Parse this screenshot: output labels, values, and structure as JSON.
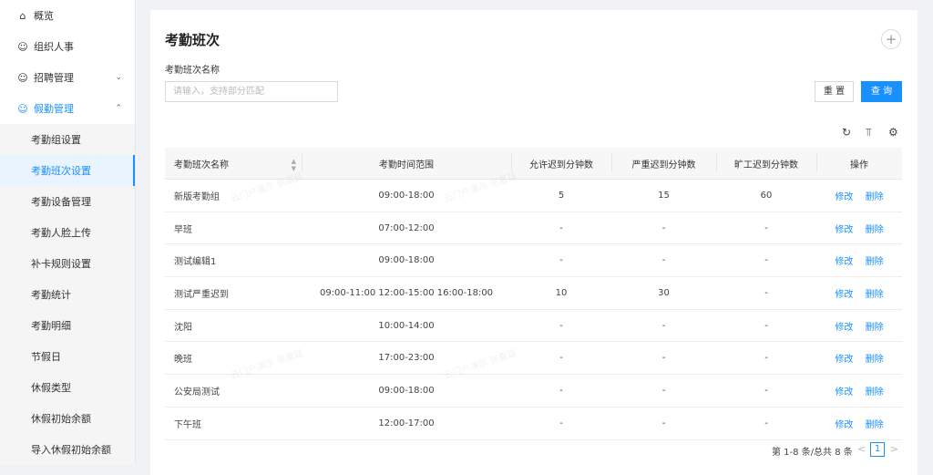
{
  "sidebar": {
    "top_items": [
      {
        "label": "概览",
        "icon": "home-icon"
      },
      {
        "label": "组织人事",
        "icon": "user-icon"
      },
      {
        "label": "招聘管理",
        "icon": "user-icon"
      },
      {
        "label": "假勤管理",
        "icon": "user-icon"
      }
    ],
    "sub_items": [
      {
        "label": "考勤组设置"
      },
      {
        "label": "考勤班次设置"
      },
      {
        "label": "考勤设备管理"
      },
      {
        "label": "考勤人脸上传"
      },
      {
        "label": "补卡规则设置"
      },
      {
        "label": "考勤统计"
      },
      {
        "label": "考勤明细"
      },
      {
        "label": "节假日"
      },
      {
        "label": "休假类型"
      },
      {
        "label": "休假初始余额"
      },
      {
        "label": "导入休假初始余额"
      }
    ],
    "active_sub": "考勤班次设置"
  },
  "page": {
    "title": "考勤班次",
    "add_button": "+"
  },
  "filter": {
    "label": "考勤班次名称",
    "placeholder": "请输入，支持部分匹配",
    "value": "",
    "reset_label": "重 置",
    "query_label": "查 询"
  },
  "toolbar": {
    "refresh_icon": "refresh-icon",
    "density_icon": "column-height-icon",
    "settings_icon": "gear-icon"
  },
  "table": {
    "headers": [
      "考勤班次名称",
      "考勤时间范围",
      "允许迟到分钟数",
      "严重迟到分钟数",
      "旷工迟到分钟数",
      "操作"
    ],
    "edit_label": "修改",
    "delete_label": "删除",
    "rows": [
      {
        "name": "新版考勤组",
        "range": "09:00-18:00",
        "allow": "5",
        "severe": "15",
        "absent": "60"
      },
      {
        "name": "早班",
        "range": "07:00-12:00",
        "allow": "-",
        "severe": "-",
        "absent": "-"
      },
      {
        "name": "测试编辑1",
        "range": "09:00-18:00",
        "allow": "-",
        "severe": "-",
        "absent": "-"
      },
      {
        "name": "测试严重迟到",
        "range": "09:00-11:00 12:00-15:00 16:00-18:00",
        "allow": "10",
        "severe": "30",
        "absent": "-"
      },
      {
        "name": "沈阳",
        "range": "10:00-14:00",
        "allow": "-",
        "severe": "-",
        "absent": "-"
      },
      {
        "name": "晚班",
        "range": "17:00-23:00",
        "allow": "-",
        "severe": "-",
        "absent": "-"
      },
      {
        "name": "公安局测试",
        "range": "09:00-18:00",
        "allow": "-",
        "severe": "-",
        "absent": "-"
      },
      {
        "name": "下午班",
        "range": "12:00-17:00",
        "allow": "-",
        "severe": "-",
        "absent": "-"
      }
    ]
  },
  "pagination": {
    "summary": "第 1-8 条/总共 8 条",
    "current_page": "1",
    "prev": "<",
    "next": ">"
  },
  "watermark": "云门户演示 张嘉廷"
}
